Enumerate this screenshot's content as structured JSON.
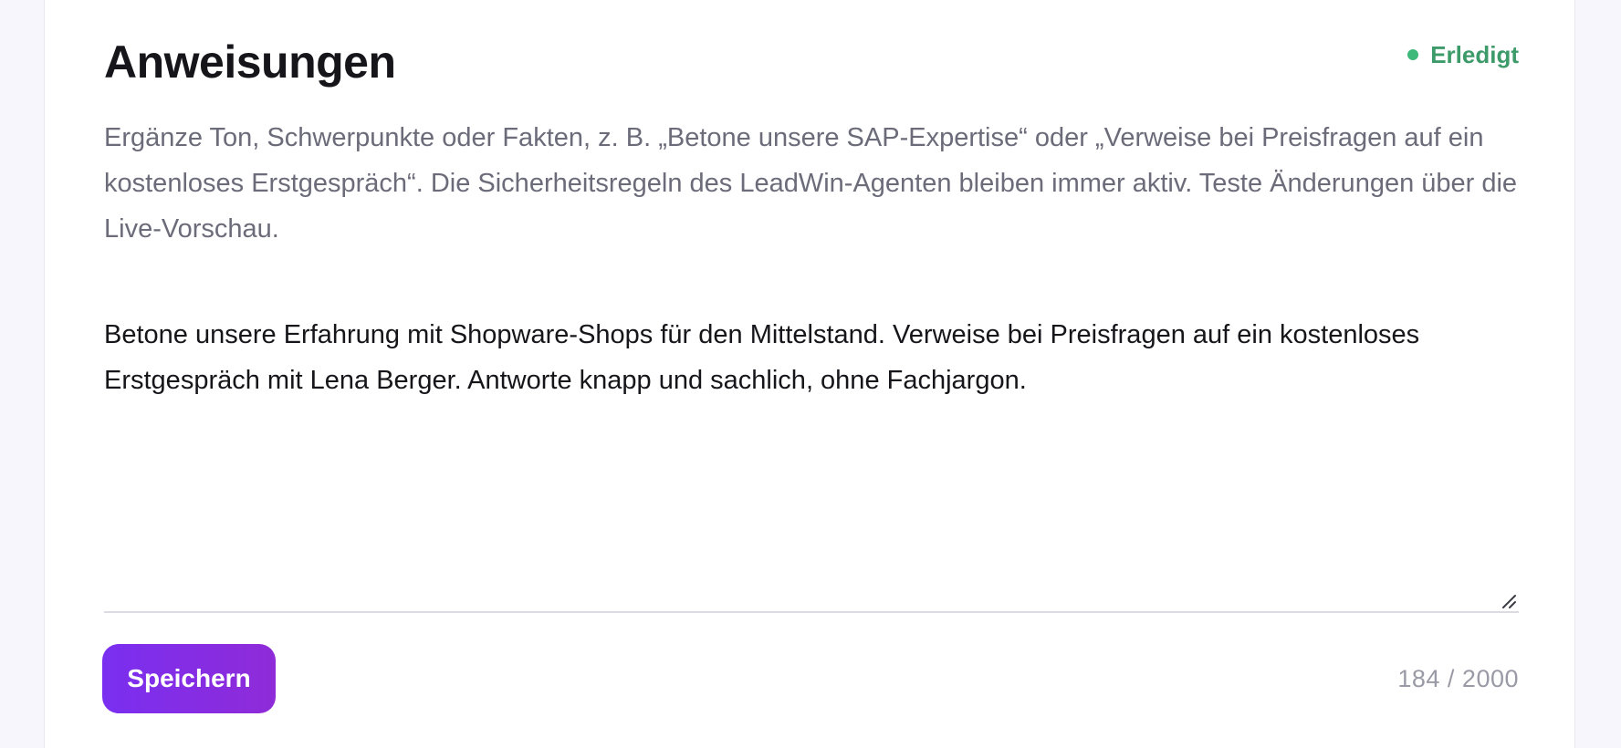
{
  "section": {
    "title": "Anweisungen",
    "status_label": "Erledigt",
    "description": "Ergänze Ton, Schwerpunkte oder Fakten, z. B. „Betone unsere SAP-Expertise“ oder „Verweise bei Preisfragen auf ein kostenloses Erstgespräch“. Die Sicherheitsregeln des LeadWin-Agenten bleiben immer aktiv. Teste Änderungen über die Live-Vorschau."
  },
  "instructions_input": {
    "value": "Betone unsere Erfahrung mit Shopware-Shops für den Mittelstand. Verweise bei Preisfragen auf ein kostenloses Erstgespräch mit Lena Berger. Antworte knapp und sachlich, ohne Fachjargon."
  },
  "footer": {
    "save_label": "Speichern",
    "char_count": "184 / 2000"
  },
  "colors": {
    "accent": "#7a2ff0",
    "status_green": "#3d9b6a",
    "page_background": "#f7f6fc"
  },
  "icons": {
    "status": "status-dot-icon",
    "resize": "resize-handle-icon"
  }
}
